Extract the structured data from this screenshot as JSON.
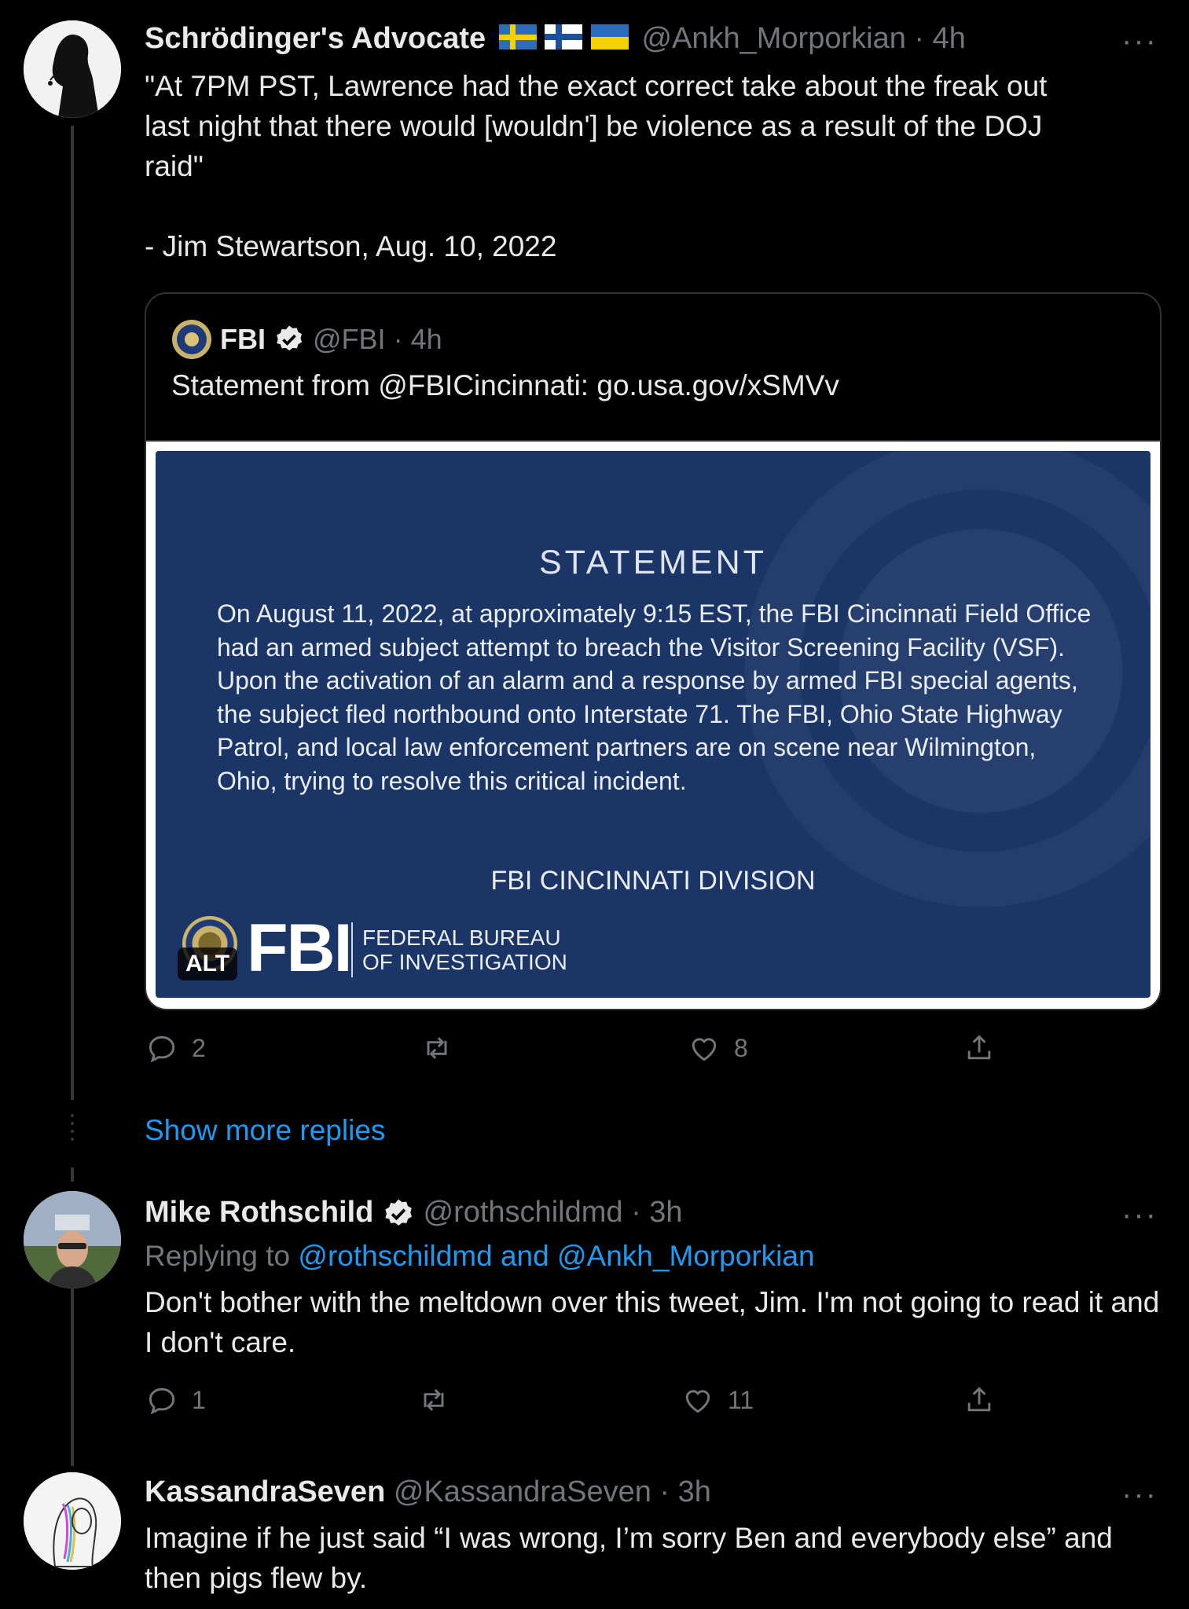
{
  "tweet1": {
    "name": "Schrödinger's Advocate",
    "flags": [
      "SE",
      "FI",
      "UA"
    ],
    "handle": "@Ankh_Morporkian",
    "time": "4h",
    "text": "\"At 7PM PST, Lawrence had the exact correct take about the freak out\nlast night that there would [wouldn'] be violence as a result of the DOJ\nraid\"\n\n- Jim Stewartson, Aug. 10, 2022",
    "replies": "2",
    "retweets": "",
    "likes": "8"
  },
  "quote": {
    "name": "FBI",
    "handle": "@FBI",
    "time": "4h",
    "text": "Statement from @FBICincinnati: go.usa.gov/xSMVv",
    "image": {
      "title": "STATEMENT",
      "body": "On August 11, 2022, at approximately 9:15 EST, the FBI Cincinnati Field Office had an armed subject attempt to breach the Visitor Screening Facility (VSF). Upon the activation of an alarm and a response by armed FBI special agents, the subject fled northbound onto Interstate 71. The FBI, Ohio State Highway Patrol, and local law enforcement partners are on scene near Wilmington, Ohio, trying to resolve this critical incident.",
      "signature": "FBI CINCINNATI DIVISION",
      "logo_text": "FBI",
      "logo_sub_1": "FEDERAL BUREAU",
      "logo_sub_2": "OF INVESTIGATION",
      "alt_badge": "ALT"
    }
  },
  "show_more": "Show more replies",
  "tweet2": {
    "name": "Mike Rothschild",
    "handle": "@rothschildmd",
    "time": "3h",
    "replying_prefix": "Replying to",
    "replying_to": "@rothschildmd and @Ankh_Morporkian",
    "text": "Don't bother with the meltdown over this tweet, Jim. I'm not going to read it and I don't care.",
    "replies": "1",
    "retweets": "",
    "likes": "11"
  },
  "tweet3": {
    "name": "KassandraSeven",
    "handle": "@KassandraSeven",
    "time": "3h",
    "text": "Imagine if he just said “I was wrong, I’m sorry Ben and everybody else” and then pigs flew by."
  },
  "separator": "·",
  "more_glyph": "···",
  "colors": {
    "background": "#000000",
    "text": "#e7e9ea",
    "muted": "#71767b",
    "link": "#1d9bf0",
    "fbi_panel": "#1b3567"
  }
}
